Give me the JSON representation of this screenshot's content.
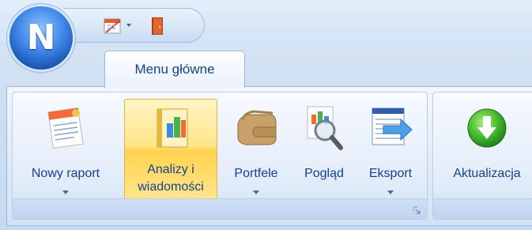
{
  "tabs": [
    {
      "label": "Menu główne"
    }
  ],
  "ribbon": {
    "buttons": [
      {
        "label": "Nowy raport",
        "icon": "new-report-icon",
        "has_dropdown": true
      },
      {
        "label": "Analizy i\nwiadomości",
        "icon": "analysis-news-icon",
        "selected": true
      },
      {
        "label": "Portfele",
        "icon": "wallet-icon",
        "has_dropdown": true
      },
      {
        "label": "Pogląd",
        "icon": "preview-magnifier-icon"
      },
      {
        "label": "Eksport",
        "icon": "export-arrow-icon",
        "has_dropdown": true
      },
      {
        "label": "Aktualizacja",
        "icon": "update-download-icon"
      }
    ]
  },
  "app_button": {
    "letter": "N"
  },
  "quick_access": [
    {
      "icon": "calendar-icon",
      "has_dropdown": true
    },
    {
      "icon": "exit-door-icon"
    }
  ],
  "colors": {
    "text": "#15428b",
    "selected_bg": "#ffd24d",
    "ribbon_border": "#9ab6df"
  }
}
